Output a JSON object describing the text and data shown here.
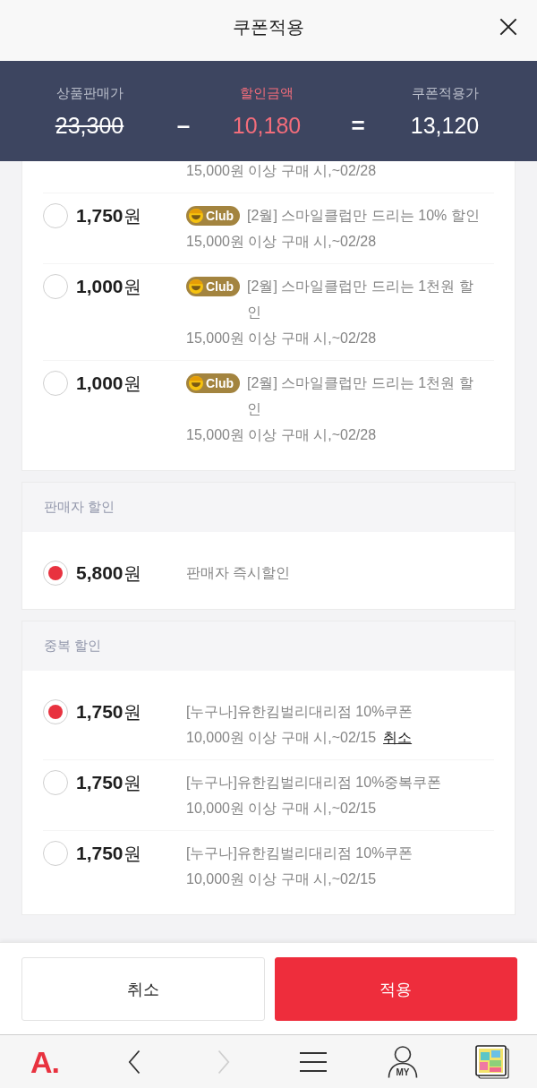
{
  "header": {
    "title": "쿠폰적용"
  },
  "summary": {
    "columns": [
      {
        "kind": "original",
        "label": "상품판매가",
        "value": "23,300"
      },
      {
        "kind": "discount",
        "label": "할인금액",
        "value": "10,180"
      },
      {
        "kind": "final",
        "label": "쿠폰적용가",
        "value": "13,120"
      }
    ],
    "operators": [
      "–",
      "="
    ]
  },
  "sections": [
    {
      "scrolled_detail": "15,000원 이상 구매 시,~02/28",
      "items": [
        {
          "amount": "**1,750**원",
          "selected": false,
          "badge": "Club",
          "title": "[2월] 스마일클럽만 드리는 10% 할인",
          "detail": "15,000원 이상 구매 시,~02/28"
        },
        {
          "amount": "**1,000**원",
          "selected": false,
          "badge": "Club",
          "title": "[2월] 스마일클럽만 드리는 1천원 할인",
          "detail": "15,000원 이상 구매 시,~02/28"
        },
        {
          "amount": "**1,000**원",
          "selected": false,
          "badge": "Club",
          "title": "[2월] 스마일클럽만 드리는 1천원 할인",
          "detail": "15,000원 이상 구매 시,~02/28"
        }
      ]
    },
    {
      "heading": "판매자 할인",
      "items": [
        {
          "amount": "**5,800**원",
          "selected": true,
          "title": "판매자 즉시할인"
        }
      ]
    },
    {
      "heading": "중복 할인",
      "items": [
        {
          "amount": "**1,750**원",
          "selected": true,
          "title": "[누구나]유한킴벌리대리점 10%쿠폰",
          "detail": "10,000원 이상 구매 시,~02/15",
          "cancel_link": "취소"
        },
        {
          "amount": "**1,750**원",
          "selected": false,
          "title": "[누구나]유한킴벌리대리점 10%중복쿠폰",
          "detail": "10,000원 이상 구매 시,~02/15"
        },
        {
          "amount": "**1,750**원",
          "selected": false,
          "title": "[누구나]유한킴벌리대리점 10%쿠폰",
          "detail": "10,000원 이상 구매 시,~02/15"
        }
      ]
    }
  ],
  "actions": [
    {
      "kind": "secondary",
      "label": "취소"
    },
    {
      "kind": "primary",
      "label": "적용"
    }
  ],
  "browser_bar": {
    "logo": "A.",
    "items": [
      {
        "kind": "back",
        "disabled": false
      },
      {
        "kind": "forward",
        "disabled": true
      },
      {
        "kind": "menu"
      },
      {
        "kind": "my",
        "label": "MY"
      },
      {
        "kind": "tabs"
      }
    ]
  }
}
